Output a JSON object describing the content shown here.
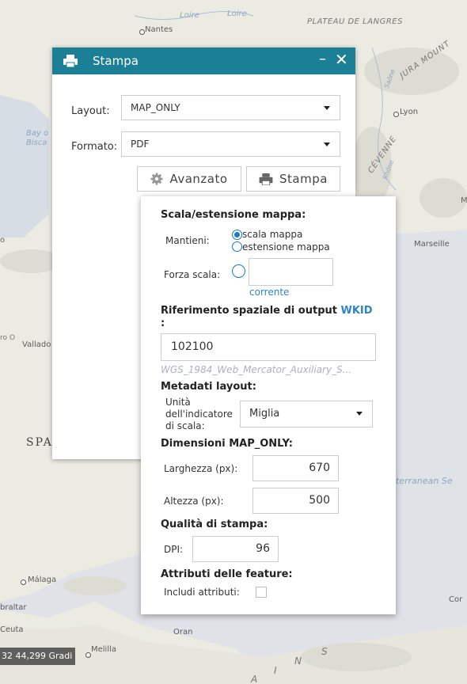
{
  "map": {
    "labels": {
      "loire1": "Loire",
      "loire2": "Loire",
      "nantes": "Nantes",
      "plateau": "PLATEAU DE LANGRES",
      "jura": "JURA MOUNT",
      "saone": "Saône",
      "lyon": "Lyon",
      "cevennes": "CÉVENNE",
      "rhone": "Rhône",
      "bay1": "Bay o",
      "bay2": "Bisca",
      "marseille": "Marseille",
      "vallado": "Vallado",
      "spa": "SPA",
      "mediterranean": "iterranean Se",
      "malaga": "Málaga",
      "braltar": "braltar",
      "ceuta": "Ceuta",
      "oran": "Oran",
      "melilla": "Melilla",
      "cor": "Cor",
      "atlas1": "A",
      "atlas2": "I",
      "atlas3": "N",
      "atlas4": "S",
      "m_edge": "M",
      "edge_zero": "ro O",
      "edge_p": "o"
    },
    "scale_readout": "32 44,299 Gradi"
  },
  "window": {
    "title": "Stampa",
    "minimize": "–",
    "close": "✕",
    "layout_label": "Layout:",
    "layout_value": "MAP_ONLY",
    "format_label": "Formato:",
    "format_value": "PDF",
    "advanced_button": "Avanzato",
    "print_button": "Stampa"
  },
  "advanced": {
    "scale_section": "Scala/estensione mappa:",
    "keep_label": "Mantieni:",
    "option_scale": "scala mappa",
    "option_extent": "estensione mappa",
    "force_scale_label": "Forza scala:",
    "force_scale_value": "",
    "current_link": "corrente",
    "sr_section_prefix": "Riferimento spaziale di output",
    "sr_wkid_link": "WKID",
    "sr_colon": ":",
    "wkid_value": "102100",
    "wkid_name": "WGS_1984_Web_Mercator_Auxiliary_S...",
    "metadata_section": "Metadati layout:",
    "units_label_1": "Unità",
    "units_label_2": "dell'indicatore",
    "units_label_3": "di scala:",
    "units_value": "Miglia",
    "dimensions_section": "Dimensioni MAP_ONLY:",
    "width_label": "Larghezza (px):",
    "width_value": "670",
    "height_label": "Altezza (px):",
    "height_value": "500",
    "quality_section": "Qualità di stampa:",
    "dpi_label": "DPI:",
    "dpi_value": "96",
    "feature_section": "Attributi delle feature:",
    "include_label": "Includi attributi:",
    "include_checked": false
  },
  "colors": {
    "titlebar": "#1b8095",
    "link": "#2f84c6",
    "radio": "#1a79c4"
  }
}
